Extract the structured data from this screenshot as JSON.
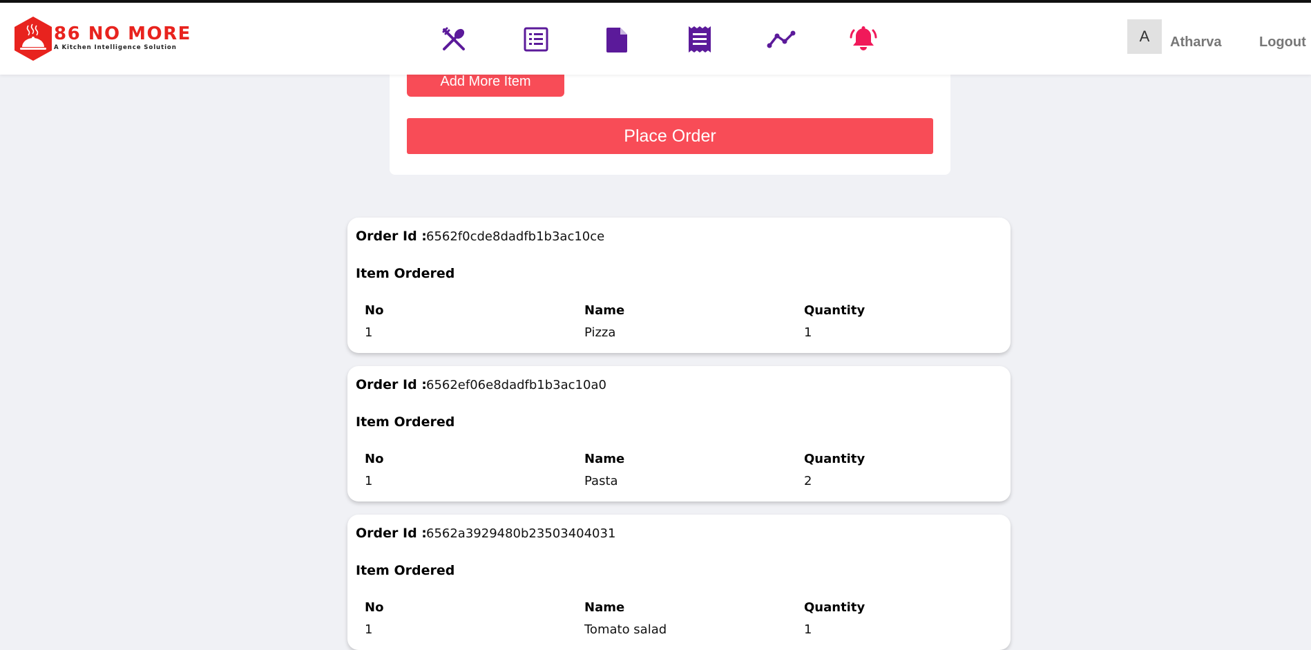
{
  "brand": {
    "title": "86 NO MORE",
    "subtitle": "A Kitchen Intelligence Solution",
    "color": "#e8231e"
  },
  "nav": {
    "icons": [
      "utensils-icon",
      "menu-list-icon",
      "document-icon",
      "receipt-icon",
      "analytics-icon",
      "notifications-bell-icon"
    ],
    "icon_color": "#5b1a9a",
    "bell_color": "#f0195a"
  },
  "user": {
    "avatar_initial": "A",
    "name": "Atharva",
    "logout_label": "Logout"
  },
  "order_form": {
    "add_more_label": "Add More Item",
    "place_order_label": "Place Order",
    "button_color": "#f84c57"
  },
  "labels": {
    "order_id": "Order Id :",
    "item_ordered": "Item Ordered",
    "col_no": "No",
    "col_name": "Name",
    "col_quantity": "Quantity"
  },
  "orders": [
    {
      "id": "6562f0cde8dadfb1b3ac10ce",
      "items": [
        {
          "no": "1",
          "name": "Pizza",
          "quantity": "1"
        }
      ]
    },
    {
      "id": "6562ef06e8dadfb1b3ac10a0",
      "items": [
        {
          "no": "1",
          "name": "Pasta",
          "quantity": "2"
        }
      ]
    },
    {
      "id": "6562a3929480b23503404031",
      "items": [
        {
          "no": "1",
          "name": "Tomato salad",
          "quantity": "1"
        }
      ]
    }
  ]
}
